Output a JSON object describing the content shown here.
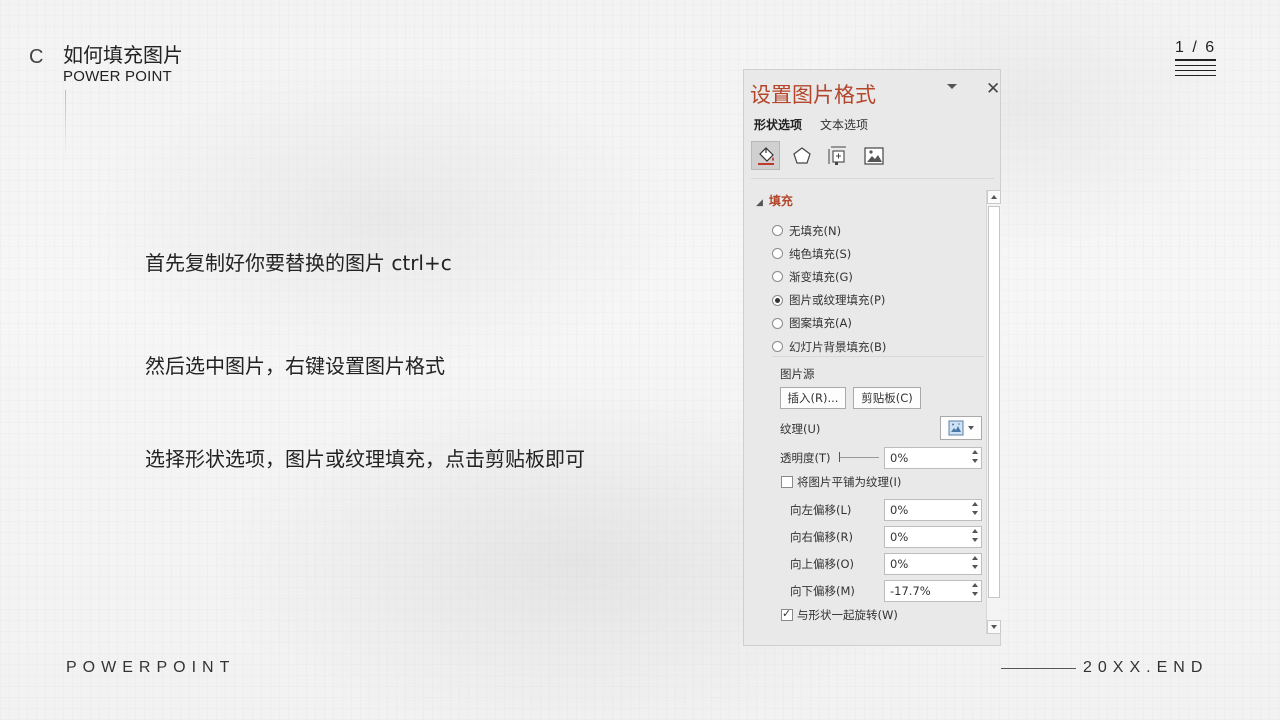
{
  "slide": {
    "logo_letter": "C",
    "title_cn": "如何填充图片",
    "title_en": "POWER POINT",
    "page_indicator": "1 / 6",
    "steps": [
      "首先复制好你要替换的图片  ctrl+c",
      "然后选中图片，右键设置图片格式",
      "选择形状选项，图片或纹理填充，点击剪贴板即可"
    ],
    "footer_left": "POWERPOINT",
    "footer_right": "20XX.END"
  },
  "pane": {
    "title": "设置图片格式",
    "tabs": [
      "形状选项",
      "文本选项"
    ],
    "active_tab": "形状选项",
    "category_icons": [
      "fill-bucket-icon",
      "pentagon-shape-icon",
      "size-layout-icon",
      "picture-icon"
    ],
    "fill_section": {
      "header": "填充",
      "options": [
        {
          "label": "无填充(N)",
          "checked": false
        },
        {
          "label": "纯色填充(S)",
          "checked": false
        },
        {
          "label": "渐变填充(G)",
          "checked": false
        },
        {
          "label": "图片或纹理填充(P)",
          "checked": true
        },
        {
          "label": "图案填充(A)",
          "checked": false
        },
        {
          "label": "幻灯片背景填充(B)",
          "checked": false
        }
      ],
      "picture_source_label": "图片源",
      "insert_button": "插入(R)...",
      "clipboard_button": "剪贴板(C)",
      "texture_label": "纹理(U)",
      "transparency_label": "透明度(T)",
      "transparency_value": "0%",
      "tile_label": "将图片平铺为纹理(I)",
      "tile_checked": false,
      "offsets": [
        {
          "label": "向左偏移(L)",
          "value": "0%"
        },
        {
          "label": "向右偏移(R)",
          "value": "0%"
        },
        {
          "label": "向上偏移(O)",
          "value": "0%"
        },
        {
          "label": "向下偏移(M)",
          "value": "-17.7%"
        }
      ],
      "rotate_label": "与形状一起旋转(W)",
      "rotate_checked": true
    }
  },
  "colors": {
    "pane_title": "#b4462c",
    "accent_line": "#d9b88b"
  }
}
